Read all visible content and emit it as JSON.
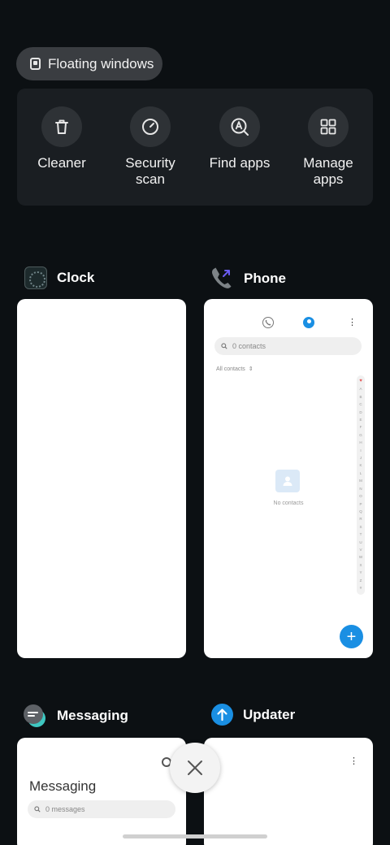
{
  "floating_windows": {
    "label": "Floating windows",
    "icon": "floating-window-icon"
  },
  "tools": [
    {
      "label": "Cleaner",
      "icon": "trash-icon"
    },
    {
      "label": "Security\nscan",
      "icon": "gauge-icon"
    },
    {
      "label": "Find apps",
      "icon": "find-apps-icon"
    },
    {
      "label": "Manage\napps",
      "icon": "grid-icon"
    }
  ],
  "recents": {
    "clock": {
      "name": "Clock",
      "icon": "clock-app-icon"
    },
    "phone": {
      "name": "Phone",
      "icon": "phone-app-icon",
      "search_placeholder": "0 contacts",
      "filter": "All contacts",
      "empty_text": "No contacts",
      "alphabet": [
        "A",
        "B",
        "C",
        "D",
        "E",
        "F",
        "G",
        "H",
        "I",
        "J",
        "K",
        "L",
        "M",
        "N",
        "O",
        "P",
        "Q",
        "R",
        "S",
        "T",
        "U",
        "V",
        "W",
        "X",
        "Y",
        "Z",
        "#"
      ],
      "fab": "+"
    },
    "messaging": {
      "name": "Messaging",
      "icon": "messaging-app-icon",
      "title": "Messaging",
      "search_placeholder": "0 messages"
    },
    "updater": {
      "name": "Updater",
      "icon": "updater-app-icon"
    }
  },
  "colors": {
    "background": "#0c1013",
    "accent": "#1a8fe3",
    "panel": "#1a1e22"
  }
}
